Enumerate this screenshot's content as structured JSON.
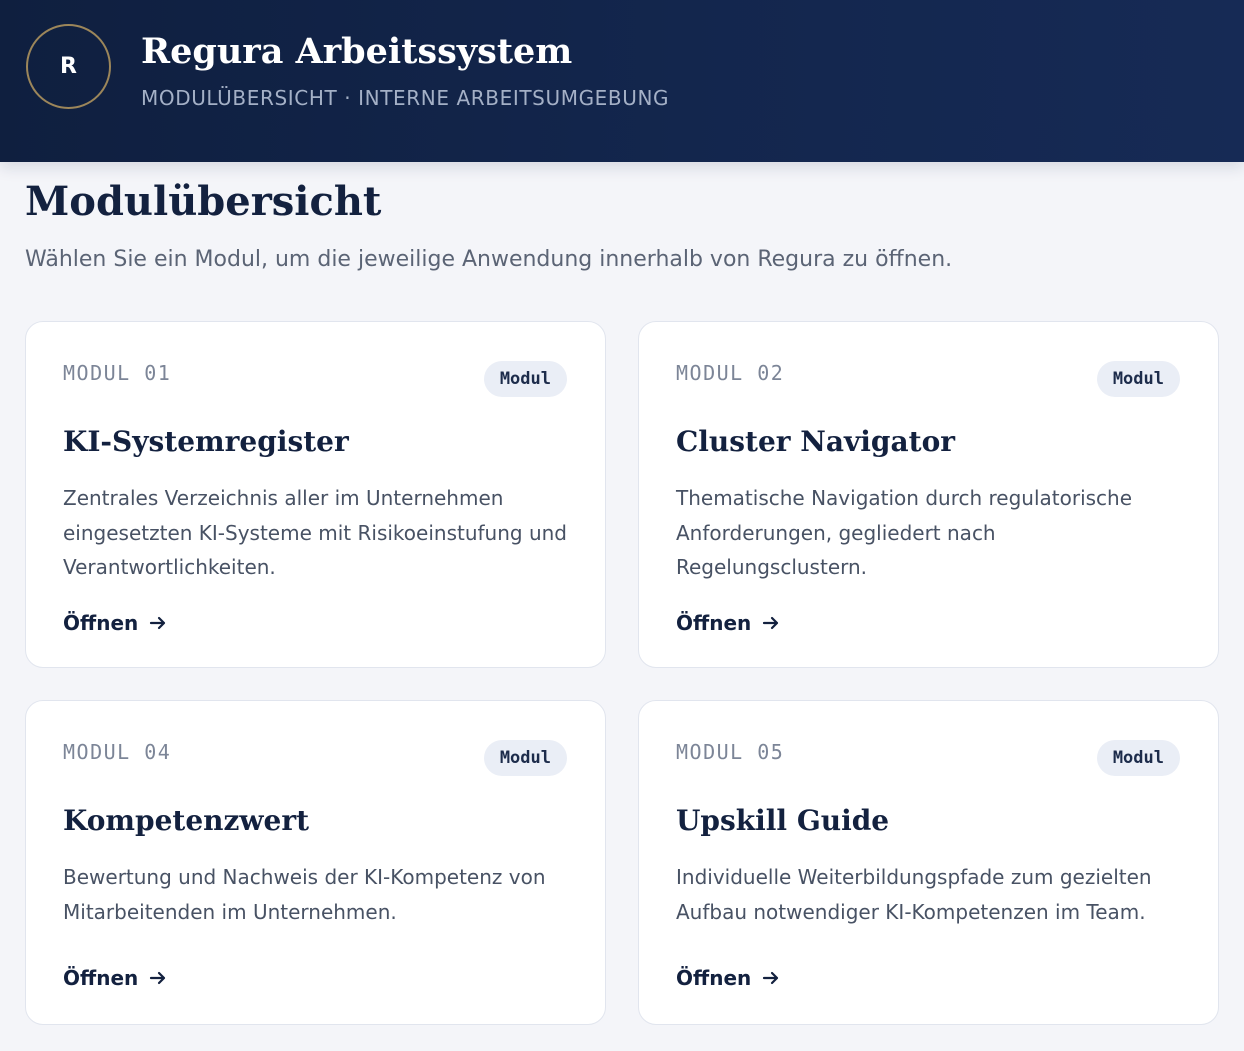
{
  "header": {
    "logo_letter": "R",
    "title": "Regura Arbeitssystem",
    "subtitle": "MODULÜBERSICHT · INTERNE ARBEITSUMGEBUNG"
  },
  "page": {
    "title": "Modulübersicht",
    "description": "Wählen Sie ein Modul, um die jeweilige Anwendung innerhalb von Regura zu öffnen."
  },
  "modules": [
    {
      "label": "MODUL 01",
      "badge": "Modul",
      "title": "KI-Systemregister",
      "description": "Zentrales Verzeichnis aller im Unternehmen eingesetzten KI-Systeme mit Risikoeinstufung und Verantwortlichkeiten.",
      "link": "Öffnen",
      "link_icon": "arrow-right-icon"
    },
    {
      "label": "MODUL 02",
      "badge": "Modul",
      "title": "Cluster Navigator",
      "description": "Thematische Navigation durch regulatorische Anforderungen, gegliedert nach Regelungsclustern.",
      "link": "Öffnen",
      "link_icon": "arrow-right-icon"
    },
    {
      "label": "MODUL 04",
      "badge": "Modul",
      "title": "Kompetenzwert",
      "description": "Bewertung und Nachweis der KI-Kompetenz von Mitarbeitenden im Unternehmen.",
      "link": "Öffnen",
      "link_icon": "arrow-right-icon"
    },
    {
      "label": "MODUL 05",
      "badge": "Modul",
      "title": "Upskill Guide",
      "description": "Individuelle Weiterbildungspfade zum gezielten Aufbau notwendiger KI-Kompetenzen im Team.",
      "link": "Öffnen",
      "link_icon": "arrow-right-icon"
    }
  ],
  "colors": {
    "header_bg": "#13264d",
    "logo_ring": "#9c865a",
    "page_bg": "#f4f5f9",
    "title_text": "#13213f",
    "badge_bg": "#eaeef6"
  }
}
